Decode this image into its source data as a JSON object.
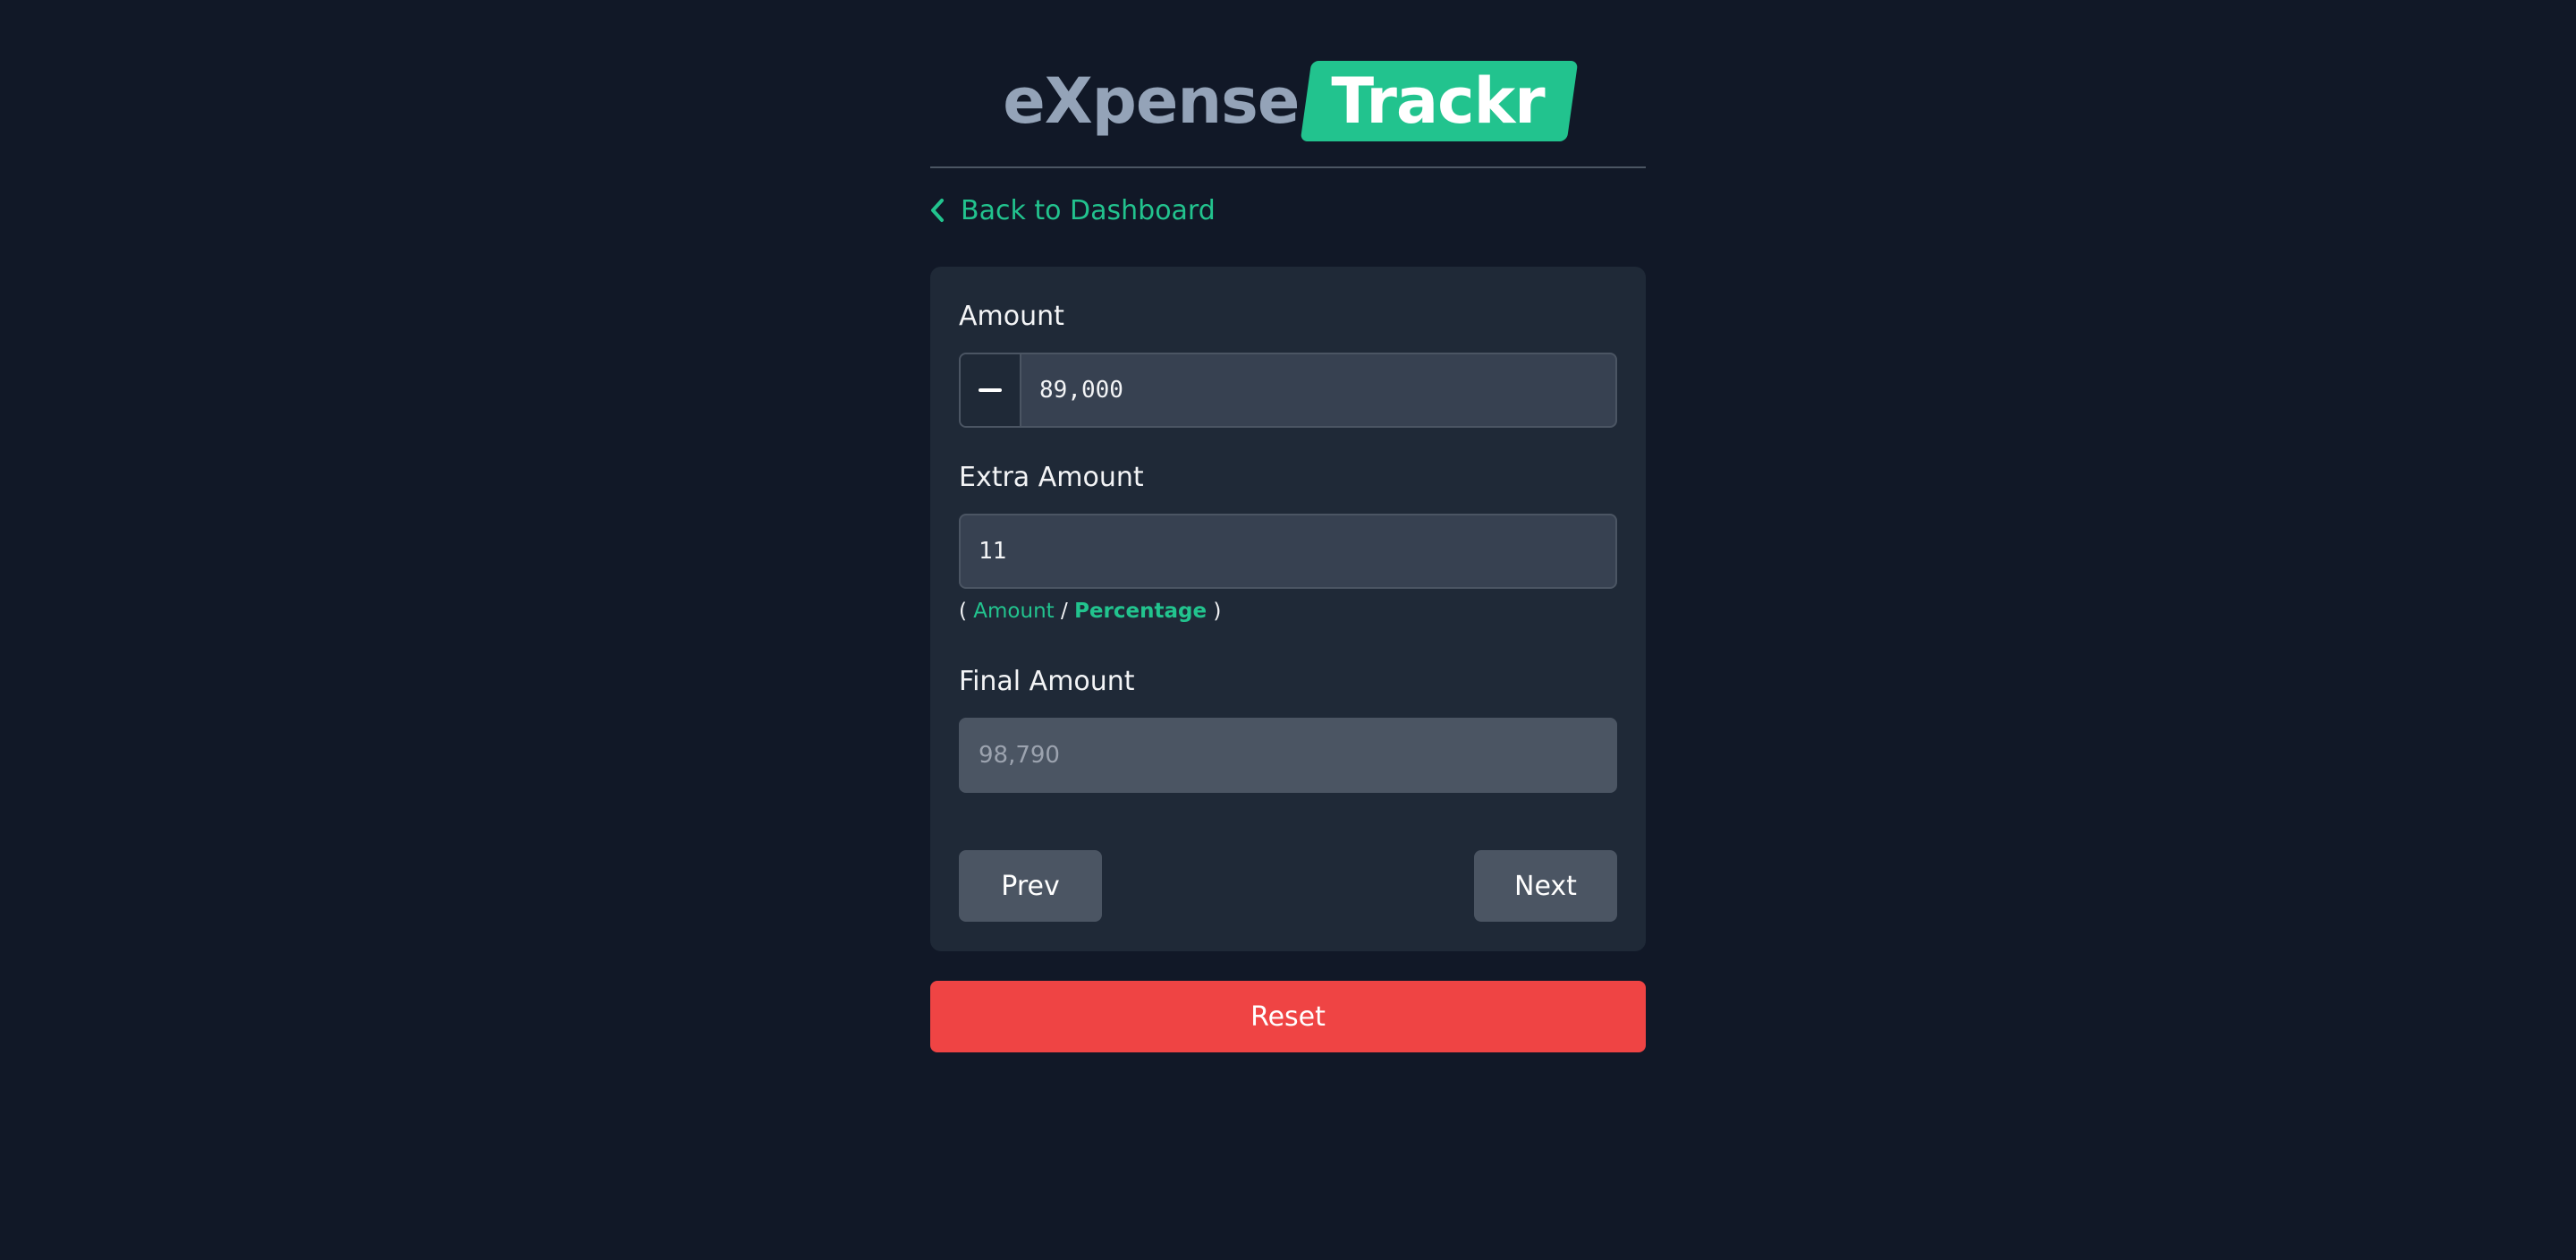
{
  "brand": {
    "logo_left": "eXpense",
    "logo_right": "Trackr"
  },
  "nav": {
    "back_label": "Back to Dashboard"
  },
  "form": {
    "amount": {
      "label": "Amount",
      "value": "89,000"
    },
    "extra_amount": {
      "label": "Extra Amount",
      "value": "11",
      "toggle_open": "(",
      "toggle_amount": "Amount",
      "toggle_separator": "/",
      "toggle_percentage": "Percentage",
      "toggle_close": ")",
      "selected_mode": "Percentage"
    },
    "final_amount": {
      "label": "Final Amount",
      "value": "98,790"
    },
    "prev_label": "Prev",
    "next_label": "Next"
  },
  "reset_label": "Reset",
  "colors": {
    "background": "#111827",
    "card": "#1f2937",
    "accent": "#22c38e",
    "danger": "#ef4444",
    "logo_muted": "#94a3b8"
  }
}
